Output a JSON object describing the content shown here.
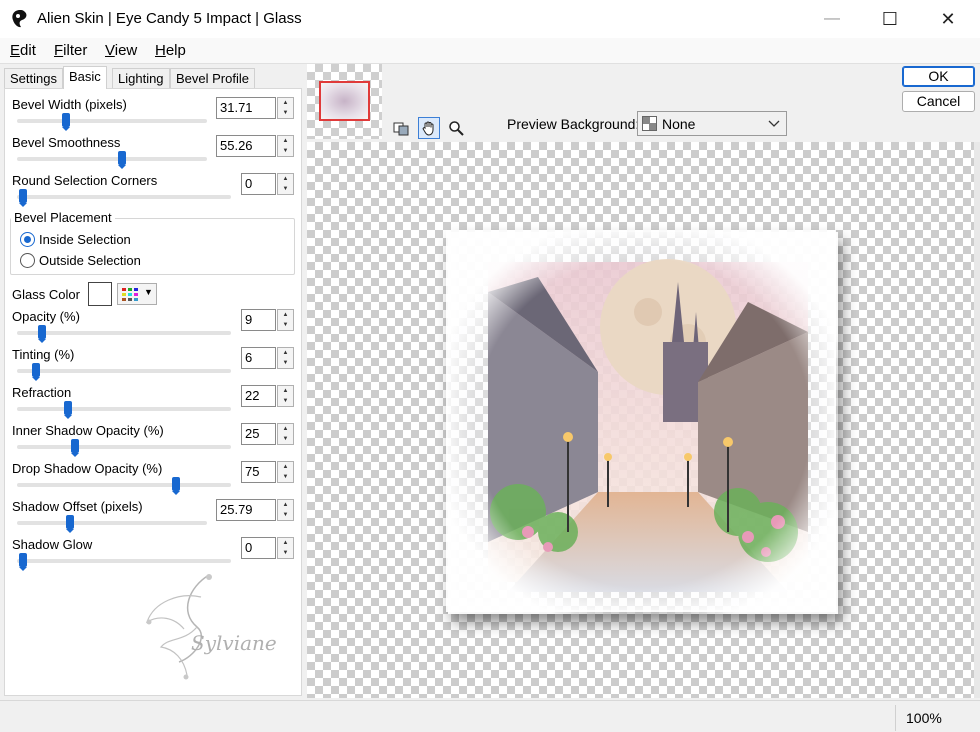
{
  "window": {
    "title": "Alien Skin | Eye Candy 5 Impact | Glass",
    "minimize_glyph": "—",
    "maximize_glyph": "☐",
    "close_glyph": "✕"
  },
  "menu": [
    "Edit",
    "Filter",
    "View",
    "Help"
  ],
  "tabs": [
    "Settings",
    "Basic",
    "Lighting",
    "Bevel Profile"
  ],
  "active_tab": "Basic",
  "controls": [
    {
      "label": "Bevel Width (pixels)",
      "value": "31.71",
      "slider": 0.25
    },
    {
      "label": "Bevel Smoothness",
      "value": "55.26",
      "slider": 0.55
    },
    {
      "label": "Round Selection Corners",
      "value": "0",
      "slider": 0.0
    },
    {
      "label": "Opacity (%)",
      "value": "9",
      "slider": 0.09
    },
    {
      "label": "Tinting (%)",
      "value": "6",
      "slider": 0.06
    },
    {
      "label": "Refraction",
      "value": "22",
      "slider": 0.22
    },
    {
      "label": "Inner Shadow Opacity (%)",
      "value": "25",
      "slider": 0.25
    },
    {
      "label": "Drop Shadow Opacity (%)",
      "value": "75",
      "slider": 0.75
    },
    {
      "label": "Shadow Offset (pixels)",
      "value": "25.79",
      "slider": 0.26
    },
    {
      "label": "Shadow Glow",
      "value": "0",
      "slider": 0.0
    }
  ],
  "bevel_placement": {
    "title": "Bevel Placement",
    "options": [
      "Inside Selection",
      "Outside Selection"
    ],
    "selected": "Inside Selection"
  },
  "glass_color": {
    "label": "Glass Color",
    "color": "#ffffff"
  },
  "buttons": {
    "ok": "OK",
    "cancel": "Cancel"
  },
  "preview": {
    "label": "Preview Background:",
    "value": "None"
  },
  "watermark": {
    "text": "Sylviane"
  },
  "zoom": "100%",
  "colors": {
    "accent": "#1868d0",
    "selection_frame": "#e03a3a"
  }
}
